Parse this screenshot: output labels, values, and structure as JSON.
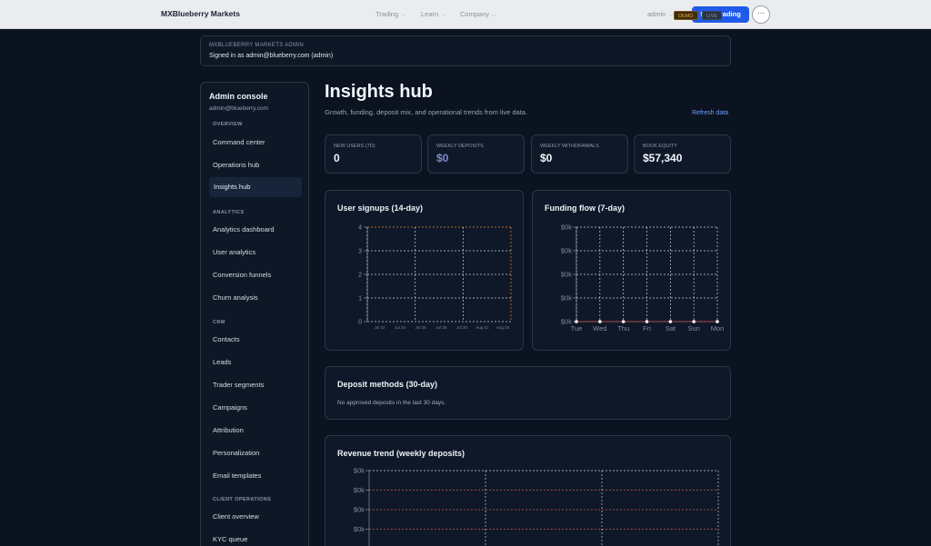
{
  "topbar": {
    "brand": "MXBlueberry Markets",
    "nav": [
      {
        "label": "Trading"
      },
      {
        "label": "Learn"
      },
      {
        "label": "Company"
      }
    ],
    "admin_label": "admin",
    "start_label": "Start trading",
    "more_icon": "⋯"
  },
  "admin_bar": {
    "label": "MXBLUEBERRY MARKETS ADMIN",
    "signed_in": "Signed in as admin@blueberry.com (admin)",
    "demo": "DEMO",
    "live": "LIVE"
  },
  "sidebar": {
    "title": "Admin console",
    "email": "admin@blueberry.com",
    "sections": [
      {
        "label": "OVERVIEW",
        "items": [
          "Command center",
          "Operations hub",
          "Insights hub"
        ]
      },
      {
        "label": "ANALYTICS",
        "items": [
          "Analytics dashboard",
          "User analytics",
          "Conversion funnels",
          "Churn analysis"
        ]
      },
      {
        "label": "CRM",
        "items": [
          "Contacts",
          "Leads",
          "Trader segments",
          "Campaigns",
          "Attribution",
          "Personalization",
          "Email templates"
        ]
      },
      {
        "label": "CLIENT OPERATIONS",
        "items": [
          "Client overview",
          "KYC queue"
        ]
      }
    ],
    "active_item": "Insights hub"
  },
  "main": {
    "title": "Insights hub",
    "subtitle": "Growth, funding, deposit mix, and operational trends from live data.",
    "refresh_label": "Refresh data"
  },
  "stats": [
    {
      "label": "NEW USERS (7D)",
      "value": "0"
    },
    {
      "label": "WEEKLY DEPOSITS",
      "value": "$0"
    },
    {
      "label": "WEEKLY WITHDRAWALS",
      "value": "$0"
    },
    {
      "label": "BOOK EQUITY",
      "value": "$57,340"
    }
  ],
  "colors": {
    "accent": "#1f5ae8",
    "deposit_value": "#7d8cc9",
    "grid_line": "#c9d0da",
    "orange_line": "#d7893b",
    "red_line": "#c95a5a"
  },
  "chart_data": [
    {
      "type": "line",
      "title": "User signups (14-day)",
      "x": [
        "Jul 22",
        "Jul 24",
        "Jul 26",
        "Jul 28",
        "Jul 30",
        "Aug 01",
        "Aug 03"
      ],
      "y_ticks": [
        "0",
        "1",
        "2",
        "3",
        "4"
      ],
      "ylim": [
        0,
        4
      ],
      "series": [],
      "grid": true
    },
    {
      "type": "line",
      "title": "Funding flow (7-day)",
      "x": [
        "Tue",
        "Wed",
        "Thu",
        "Fri",
        "Sat",
        "Sun",
        "Mon"
      ],
      "y_ticks": [
        "$0k",
        "$0k",
        "$0k",
        "$0k",
        "$0k"
      ],
      "series": [
        {
          "values": [
            0,
            0,
            0,
            0,
            0,
            0,
            0
          ]
        }
      ],
      "grid": true
    },
    {
      "type": "line",
      "title": "Revenue trend (weekly deposits)",
      "y_ticks": [
        "$0k",
        "$0k",
        "$0k",
        "$0k"
      ],
      "series": [],
      "grid": true
    }
  ],
  "deposit_methods": {
    "title": "Deposit methods (30-day)",
    "note": "No approved deposits in the last 30 days."
  }
}
